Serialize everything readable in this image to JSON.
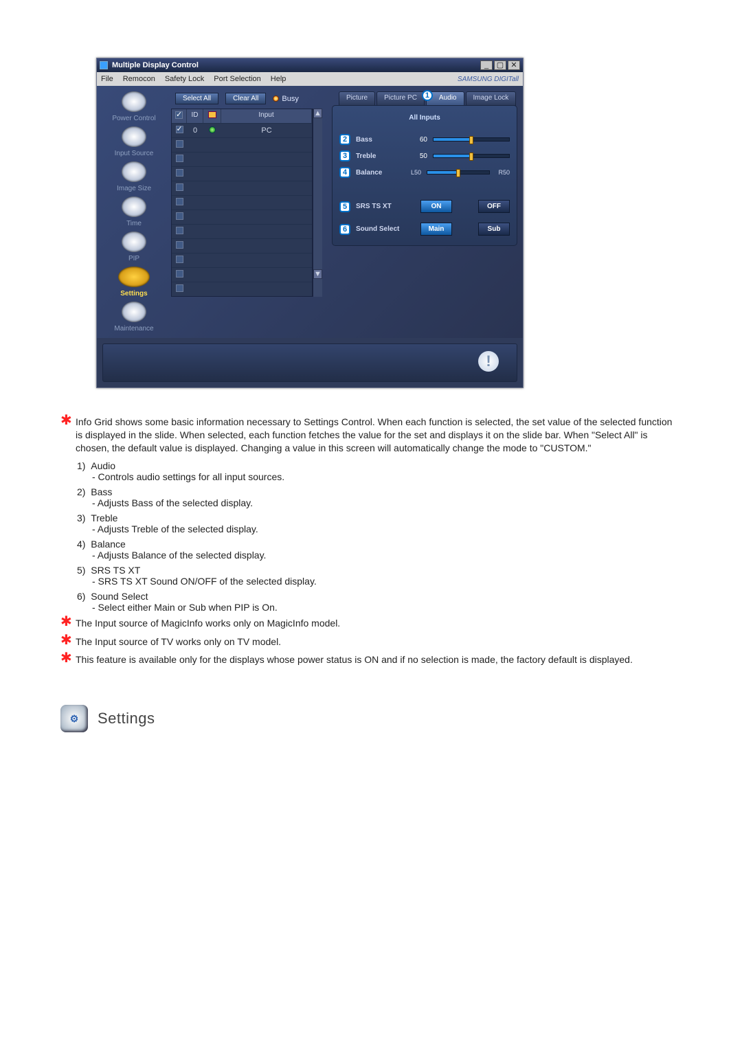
{
  "window": {
    "title": "Multiple Display Control",
    "menu": [
      "File",
      "Remocon",
      "Safety Lock",
      "Port Selection",
      "Help"
    ],
    "brand": "SAMSUNG DIGITall",
    "buttons": {
      "selectAll": "Select All",
      "clearAll": "Clear All",
      "busy": "Busy"
    },
    "sidebar": [
      {
        "label": "Power Control"
      },
      {
        "label": "Input Source"
      },
      {
        "label": "Image Size"
      },
      {
        "label": "Time"
      },
      {
        "label": "PIP"
      },
      {
        "label": "Settings",
        "selected": true
      },
      {
        "label": "Maintenance"
      }
    ],
    "gridHeaders": {
      "col1": "",
      "col2": "ID",
      "col3": "",
      "col4": "Input"
    },
    "gridRows": [
      {
        "checked": true,
        "id": "0",
        "status": "green",
        "input": "PC"
      },
      {
        "checked": false,
        "id": "",
        "status": "",
        "input": ""
      },
      {
        "checked": false,
        "id": "",
        "status": "",
        "input": ""
      },
      {
        "checked": false,
        "id": "",
        "status": "",
        "input": ""
      },
      {
        "checked": false,
        "id": "",
        "status": "",
        "input": ""
      },
      {
        "checked": false,
        "id": "",
        "status": "",
        "input": ""
      },
      {
        "checked": false,
        "id": "",
        "status": "",
        "input": ""
      },
      {
        "checked": false,
        "id": "",
        "status": "",
        "input": ""
      },
      {
        "checked": false,
        "id": "",
        "status": "",
        "input": ""
      },
      {
        "checked": false,
        "id": "",
        "status": "",
        "input": ""
      },
      {
        "checked": false,
        "id": "",
        "status": "",
        "input": ""
      },
      {
        "checked": false,
        "id": "",
        "status": "",
        "input": ""
      }
    ],
    "tabs": [
      "Picture",
      "Picture PC",
      "Audio",
      "Image Lock"
    ],
    "activeTab": "Audio",
    "panel": {
      "header": "All Inputs",
      "sliders": [
        {
          "n": "2",
          "label": "Bass",
          "value": "60"
        },
        {
          "n": "3",
          "label": "Treble",
          "value": "50"
        },
        {
          "n": "4",
          "label": "Balance",
          "left": "L50",
          "right": "R50",
          "value": ""
        }
      ],
      "toggles": [
        {
          "n": "5",
          "label": "SRS TS XT",
          "on": "ON",
          "off": "OFF"
        },
        {
          "n": "6",
          "label": "Sound Select",
          "on": "Main",
          "off": "Sub"
        }
      ],
      "tabBadge": "1"
    }
  },
  "desc": {
    "intro": "Info Grid shows some basic information necessary to Settings Control. When each function is selected, the set value of the selected function is displayed in the slide. When selected, each function fetches the value for the set and displays it on the slide bar. When \"Select All\" is chosen, the default value is displayed. Changing a value in this screen will automatically change the mode to \"CUSTOM.\"",
    "items": [
      {
        "n": "1)",
        "t": "Audio",
        "d": "- Controls audio settings for all input sources."
      },
      {
        "n": "2)",
        "t": "Bass",
        "d": "- Adjusts Bass of the selected display."
      },
      {
        "n": "3)",
        "t": "Treble",
        "d": "- Adjusts Treble of the selected display."
      },
      {
        "n": "4)",
        "t": "Balance",
        "d": "- Adjusts Balance of the selected display."
      },
      {
        "n": "5)",
        "t": "SRS TS XT",
        "d": "- SRS TS XT Sound ON/OFF of the selected display."
      },
      {
        "n": "6)",
        "t": "Sound Select",
        "d": "- Select either Main or Sub when PIP is On."
      }
    ],
    "notes": [
      "The Input source of MagicInfo works only on MagicInfo model.",
      "The Input source of TV works only on TV model.",
      "This feature is available only for the displays whose power status is ON and if no selection is made, the factory default is displayed."
    ]
  },
  "section": {
    "title": "Settings"
  }
}
